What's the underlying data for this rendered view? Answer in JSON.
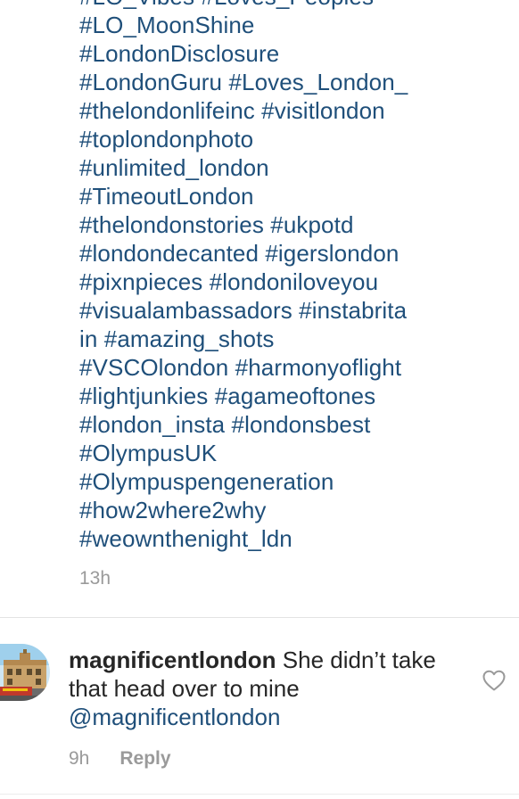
{
  "caption": {
    "hashtag_lines": [
      "#LO_Vibes #Loves_Peoples",
      "#LO_MoonShine",
      "#LondonDisclosure",
      "#LondonGuru #Loves_London_",
      "#thelondonlifeinc #visitlondon",
      "#toplondonphoto",
      "#unlimited_london",
      "#TimeoutLondon",
      "#thelondonstories  #ukpotd",
      "#londondecanted #igerslondon",
      "#pixnpieces #londoniloveyou",
      "#visualambassadors #instabrita",
      "in #amazing_shots",
      "#VSCOlondon #harmonyoflight",
      "#lightjunkies #agameoftones",
      "#london_insta #londonsbest",
      "#OlympusUK",
      "#Olympuspengeneration",
      "#how2where2why",
      "#weownthenight_ldn"
    ],
    "time": "13h"
  },
  "comment": {
    "username": "magnificentlondon",
    "text": " She didn’t take that head over to mine ",
    "mention": "@magnificentlondon",
    "time": "9h",
    "reply_label": "Reply",
    "like_icon": "heart-outline-icon"
  },
  "colors": {
    "hashtag": "#1f4f7a",
    "text": "#262626",
    "muted": "#9a9a9a",
    "divider": "#e3e3e3"
  }
}
